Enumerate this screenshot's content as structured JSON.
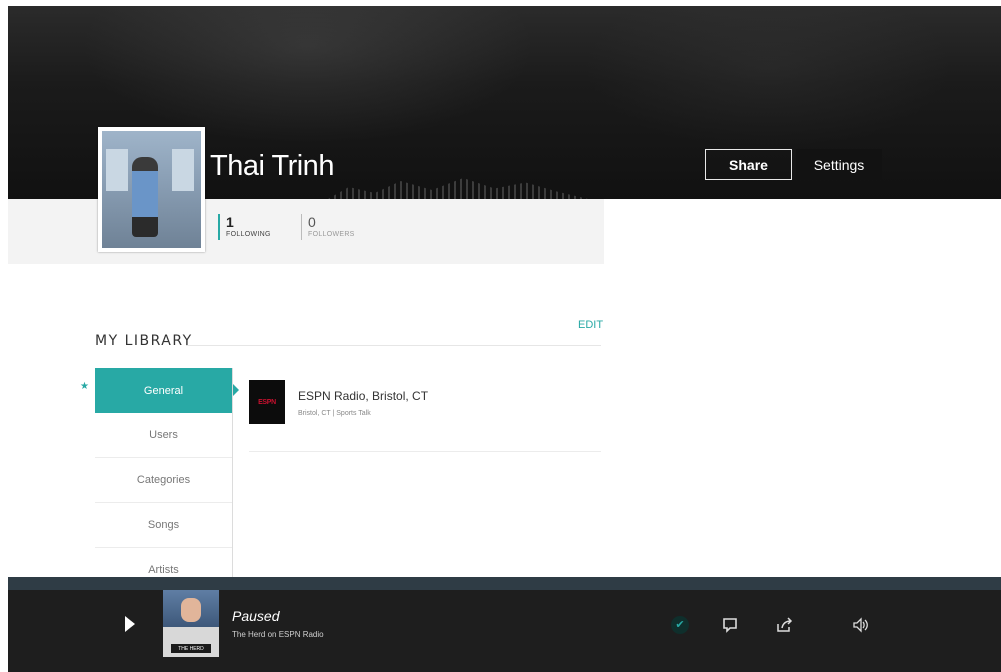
{
  "profile": {
    "name": "Thai Trinh",
    "share_label": "Share",
    "settings_label": "Settings",
    "stats": [
      {
        "value": "1",
        "label": "FOLLOWING"
      },
      {
        "value": "0",
        "label": "FOLLOWERS"
      }
    ]
  },
  "library": {
    "title": "MY LIBRARY",
    "edit_label": "EDIT",
    "star": "★",
    "menu": [
      "General",
      "Users",
      "Categories",
      "Songs",
      "Artists"
    ],
    "active_index": 0,
    "station": {
      "name": "ESPN Radio, Bristol, CT",
      "sub": "Bristol, CT  |  Sports Talk",
      "logo_text": "ESPN"
    }
  },
  "player": {
    "status": "Paused",
    "title": "The Herd on ESPN Radio",
    "album_band": "THE HERD",
    "icons": [
      "play-icon",
      "check-icon",
      "comment-icon",
      "share-icon",
      "volume-icon"
    ]
  },
  "colors": {
    "accent": "#28a9a5",
    "player_bg": "#1e1e1e",
    "strip": "#2f3c45"
  }
}
